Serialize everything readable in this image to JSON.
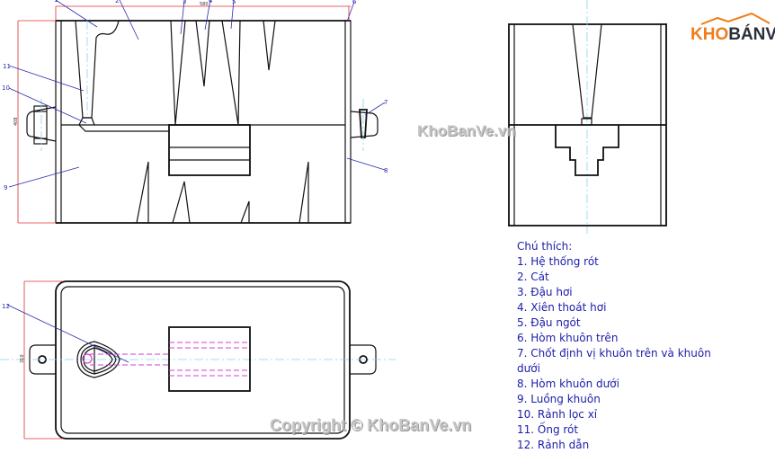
{
  "title": "",
  "dimensions": {
    "width": "580",
    "height_top": "408",
    "height_plan": "310"
  },
  "callouts": [
    "1",
    "2",
    "3",
    "4",
    "5",
    "6",
    "7",
    "8",
    "9",
    "10",
    "11",
    "12"
  ],
  "legend": {
    "heading": "Chú thích:",
    "items": [
      "1. Hệ thống rót",
      "2. Cát",
      "3. Đậu hơi",
      "4. Xiên thoát hơi",
      "5. Đậu ngót",
      "6. Hòm khuôn trên",
      "7. Chốt định vị khuôn trên và khuôn dưới",
      "8. Hòm khuôn dưới",
      "9. Luồng khuôn",
      "10. Rảnh lọc xỉ",
      "11. Ống rót",
      "12. Rảnh dẫn"
    ]
  },
  "watermarks": {
    "center": "KhoBanVe.vn",
    "bottom": "Copyright © KhoBanVe.vn"
  },
  "logo": {
    "part1": "KHO",
    "part2": "BÁNVẼ"
  },
  "colors": {
    "leader": "#2b2bb0",
    "dimension": "#e03030",
    "centerline": "#7fd8e8",
    "hidden": "#d040d0",
    "logo_orange": "#f07c1a",
    "logo_dark": "#2a2f3a",
    "legend_text": "#1c1ca8"
  }
}
